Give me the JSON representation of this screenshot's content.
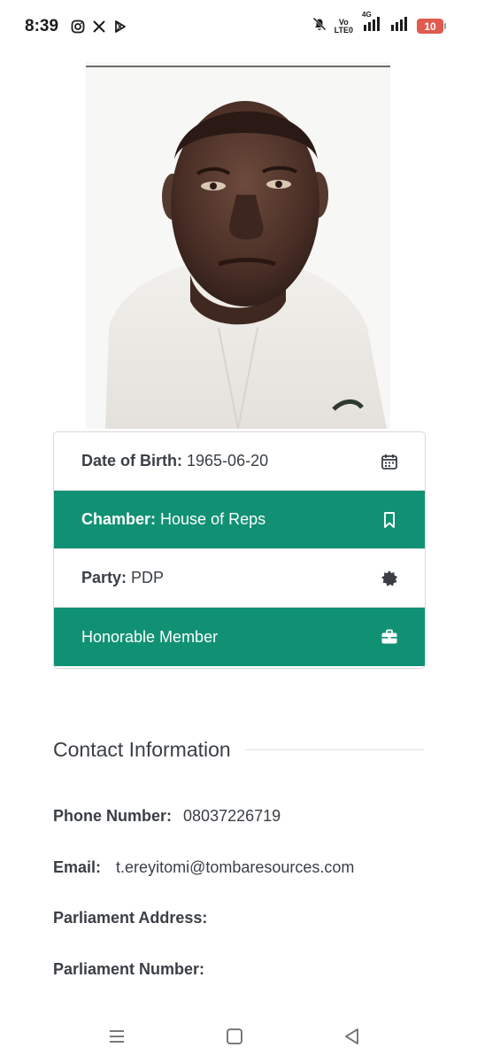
{
  "status_bar": {
    "time": "8:39",
    "app_icons": [
      "instagram-icon",
      "x-icon",
      "play-store-icon"
    ],
    "volte_label_top": "Vo",
    "volte_label_bottom": "LTE0",
    "network": "4G",
    "battery": "10"
  },
  "profile": {
    "info_rows": [
      {
        "label": "Date of Birth:",
        "value": "1965-06-20",
        "icon": "calendar-icon",
        "highlight": false
      },
      {
        "label": "Chamber:",
        "value": "House of Reps",
        "icon": "bookmark-icon",
        "highlight": true
      },
      {
        "label": "Party:",
        "value": "PDP",
        "icon": "badge-icon",
        "highlight": false
      },
      {
        "label": "",
        "value": "Honorable Member",
        "icon": "briefcase-icon",
        "highlight": true
      }
    ]
  },
  "contact": {
    "title": "Contact Information",
    "phone_label": "Phone Number:",
    "phone_value": "08037226719",
    "email_label": "Email:",
    "email_value": "t.ereyitomi@tombaresources.com",
    "address_label": "Parliament Address:",
    "number_label": "Parliament Number:"
  },
  "colors": {
    "accent": "#119174",
    "text": "#3a3f45",
    "battery": "#e05a4e"
  }
}
